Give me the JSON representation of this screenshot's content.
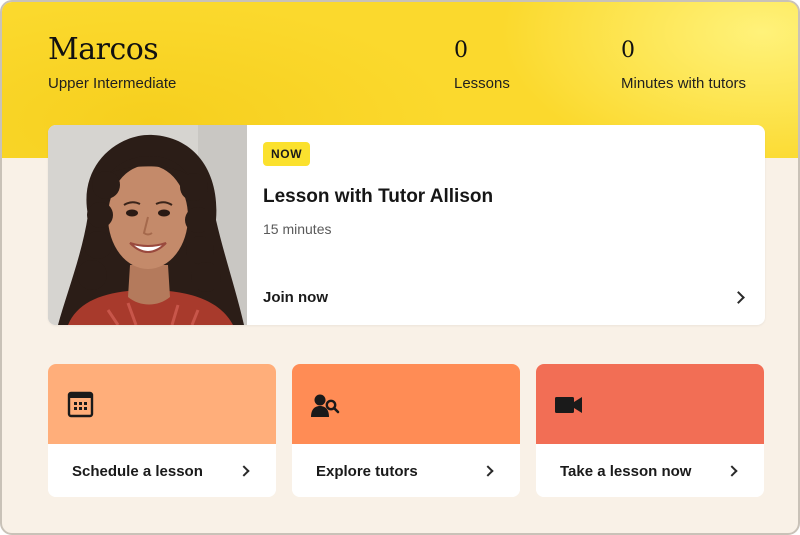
{
  "user": {
    "name": "Marcos",
    "level": "Upper Intermediate"
  },
  "stats": {
    "lessons": {
      "value": "0",
      "label": "Lessons"
    },
    "minutes": {
      "value": "0",
      "label": "Minutes with tutors"
    }
  },
  "upcoming_lesson": {
    "badge": "NOW",
    "title": "Lesson with Tutor Allison",
    "duration": "15 minutes",
    "action_label": "Join now",
    "photo_icon": "tutor-photo"
  },
  "actions": [
    {
      "label": "Schedule a lesson",
      "icon": "calendar-icon",
      "color": "#ffae7a"
    },
    {
      "label": "Explore tutors",
      "icon": "person-search-icon",
      "color": "#ff8c55"
    },
    {
      "label": "Take a lesson now",
      "icon": "video-camera-icon",
      "color": "#f26e55"
    }
  ],
  "colors": {
    "hero": "#fbd92d",
    "badge": "#fbe12e",
    "page_background": "#f9f1e7"
  }
}
